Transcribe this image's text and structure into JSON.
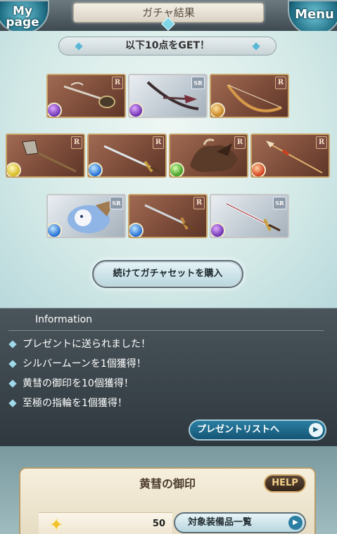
{
  "header": {
    "mypage_label": "My page",
    "title": "ガチャ結果",
    "menu_label": "Menu"
  },
  "result": {
    "banner": "以下10点をGET！",
    "items": [
      {
        "rarity": "R",
        "element": "dark",
        "icon": "claw-weapon-icon"
      },
      {
        "rarity": "SR",
        "element": "dark",
        "icon": "bow-weapon-icon"
      },
      {
        "rarity": "R",
        "element": "earth",
        "icon": "bow-weapon-icon"
      },
      {
        "rarity": "R",
        "element": "light",
        "icon": "axe-weapon-icon"
      },
      {
        "rarity": "R",
        "element": "water",
        "icon": "sword-weapon-icon"
      },
      {
        "rarity": "R",
        "element": "wind",
        "icon": "summon-creature-icon"
      },
      {
        "rarity": "R",
        "element": "fire",
        "icon": "spear-weapon-icon"
      },
      {
        "rarity": "SR",
        "element": "water",
        "icon": "summon-creature-icon"
      },
      {
        "rarity": "R",
        "element": "water",
        "icon": "dagger-weapon-icon"
      },
      {
        "rarity": "SR",
        "element": "dark",
        "icon": "sword-weapon-icon"
      }
    ],
    "buy_again_label": "続けてガチャセットを購入"
  },
  "information": {
    "title": "Information",
    "messages": [
      "プレゼントに送られました！",
      "シルバームーンを1個獲得！",
      "黄彗の御印を10個獲得！",
      "至極の指輪を1個獲得！"
    ],
    "present_list_label": "プレゼントリストへ"
  },
  "bottom_panel": {
    "title": "黄彗の御印",
    "help_label": "HELP",
    "count": "50",
    "target_list_label": "対象装備品一覧"
  }
}
